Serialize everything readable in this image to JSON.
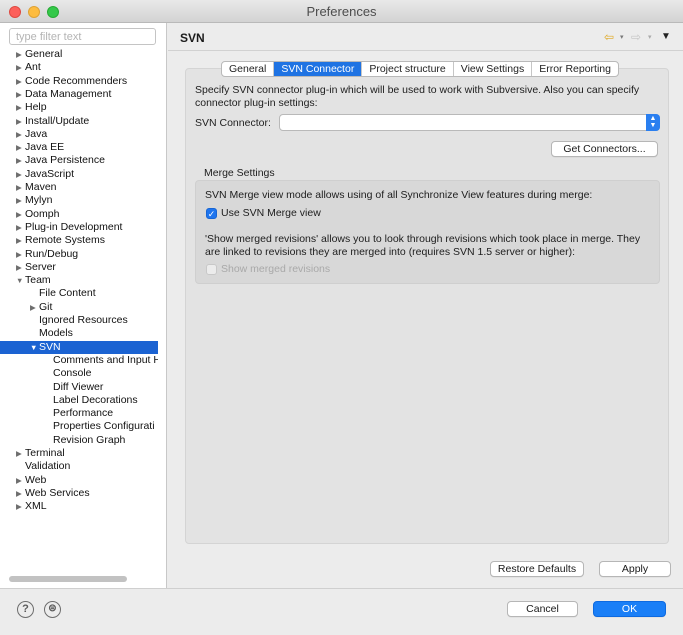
{
  "window": {
    "title": "Preferences"
  },
  "sidebar": {
    "filter_placeholder": "type filter text",
    "tree": [
      {
        "label": "General",
        "level": 0,
        "twisty": "right"
      },
      {
        "label": "Ant",
        "level": 0,
        "twisty": "right"
      },
      {
        "label": "Code Recommenders",
        "level": 0,
        "twisty": "right"
      },
      {
        "label": "Data Management",
        "level": 0,
        "twisty": "right"
      },
      {
        "label": "Help",
        "level": 0,
        "twisty": "right"
      },
      {
        "label": "Install/Update",
        "level": 0,
        "twisty": "right"
      },
      {
        "label": "Java",
        "level": 0,
        "twisty": "right"
      },
      {
        "label": "Java EE",
        "level": 0,
        "twisty": "right"
      },
      {
        "label": "Java Persistence",
        "level": 0,
        "twisty": "right"
      },
      {
        "label": "JavaScript",
        "level": 0,
        "twisty": "right"
      },
      {
        "label": "Maven",
        "level": 0,
        "twisty": "right"
      },
      {
        "label": "Mylyn",
        "level": 0,
        "twisty": "right"
      },
      {
        "label": "Oomph",
        "level": 0,
        "twisty": "right"
      },
      {
        "label": "Plug-in Development",
        "level": 0,
        "twisty": "right"
      },
      {
        "label": "Remote Systems",
        "level": 0,
        "twisty": "right"
      },
      {
        "label": "Run/Debug",
        "level": 0,
        "twisty": "right"
      },
      {
        "label": "Server",
        "level": 0,
        "twisty": "right"
      },
      {
        "label": "Team",
        "level": 0,
        "twisty": "down"
      },
      {
        "label": "File Content",
        "level": 1,
        "twisty": ""
      },
      {
        "label": "Git",
        "level": 1,
        "twisty": "right"
      },
      {
        "label": "Ignored Resources",
        "level": 1,
        "twisty": ""
      },
      {
        "label": "Models",
        "level": 1,
        "twisty": ""
      },
      {
        "label": "SVN",
        "level": 1,
        "twisty": "down",
        "selected": true
      },
      {
        "label": "Comments and Input H",
        "level": 2,
        "twisty": ""
      },
      {
        "label": "Console",
        "level": 2,
        "twisty": ""
      },
      {
        "label": "Diff Viewer",
        "level": 2,
        "twisty": ""
      },
      {
        "label": "Label Decorations",
        "level": 2,
        "twisty": ""
      },
      {
        "label": "Performance",
        "level": 2,
        "twisty": ""
      },
      {
        "label": "Properties Configurati",
        "level": 2,
        "twisty": ""
      },
      {
        "label": "Revision Graph",
        "level": 2,
        "twisty": ""
      },
      {
        "label": "Terminal",
        "level": 0,
        "twisty": "right"
      },
      {
        "label": "Validation",
        "level": 0,
        "twisty": ""
      },
      {
        "label": "Web",
        "level": 0,
        "twisty": "right"
      },
      {
        "label": "Web Services",
        "level": 0,
        "twisty": "right"
      },
      {
        "label": "XML",
        "level": 0,
        "twisty": "right"
      }
    ]
  },
  "header": {
    "title": "SVN"
  },
  "tabs": [
    {
      "label": "General",
      "active": false
    },
    {
      "label": "SVN Connector",
      "active": true
    },
    {
      "label": "Project structure",
      "active": false
    },
    {
      "label": "View Settings",
      "active": false
    },
    {
      "label": "Error Reporting",
      "active": false
    }
  ],
  "connector": {
    "description": "Specify SVN connector plug-in which will be used to work with Subversive. Also you can specify connector plug-in settings:",
    "label": "SVN Connector:",
    "value": "",
    "get_connectors_label": "Get Connectors..."
  },
  "merge": {
    "group_title": "Merge Settings",
    "mode_text": "SVN Merge view mode allows using of all Synchronize View features during merge:",
    "use_merge_view_label": "Use SVN Merge view",
    "use_merge_view_checked": true,
    "merged_revisions_text": "'Show merged revisions' allows you to look through revisions which took place in merge. They are linked to revisions they are merged into (requires SVN 1.5 server or higher):",
    "show_merged_label": "Show merged revisions",
    "show_merged_checked": false,
    "show_merged_enabled": false
  },
  "buttons": {
    "restore_defaults": "Restore Defaults",
    "apply": "Apply",
    "cancel": "Cancel",
    "ok": "OK"
  },
  "footer": {
    "help_icon": "?",
    "import_export_icon": "⊜"
  },
  "colors": {
    "accent": "#1f73e3",
    "selection": "#1b63d2",
    "back_arrow": "#e0a820"
  }
}
